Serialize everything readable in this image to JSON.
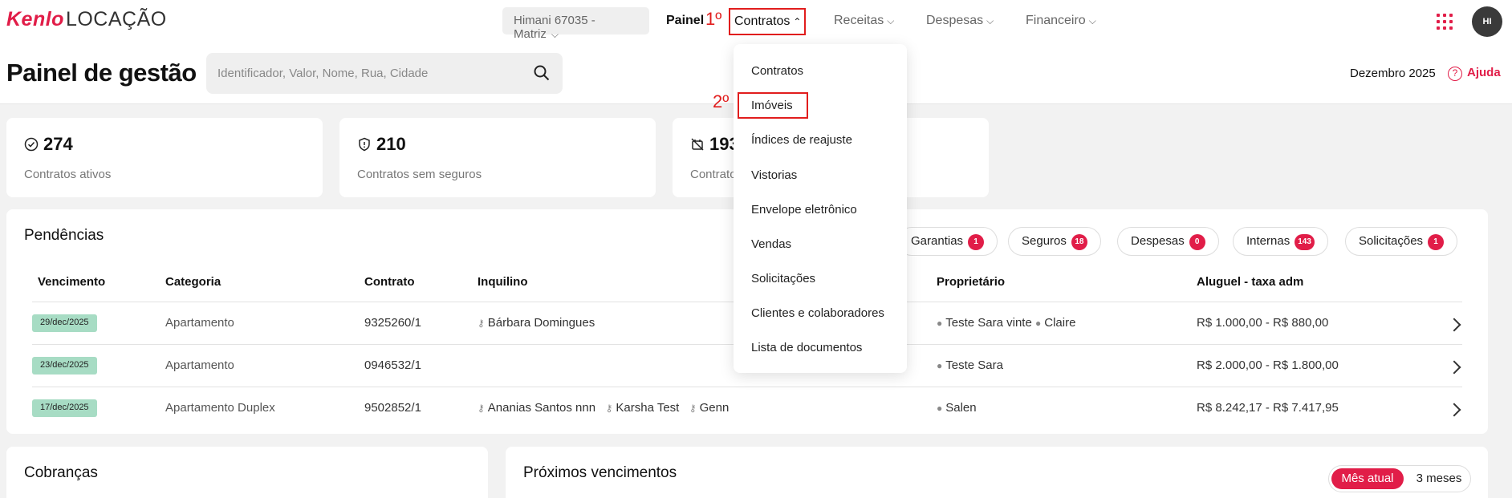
{
  "logo": {
    "brand": "Kenlo",
    "product": "LOCAÇÃO"
  },
  "topnav": {
    "branch": "Himani 67035 - Matriz",
    "painel": "Painel",
    "contratos": "Contratos",
    "receitas": "Receitas",
    "despesas": "Despesas",
    "financeiro": "Financeiro",
    "avatar_initials": "HI"
  },
  "annotations": {
    "step1": "1º",
    "step2": "2º"
  },
  "header": {
    "title": "Painel de gestão",
    "search_placeholder": "Identificador, Valor, Nome, Rua, Cidade",
    "month": "Dezembro 2025",
    "help": "Ajuda"
  },
  "stats": [
    {
      "value": "274",
      "label": "Contratos ativos",
      "icon": "check-circle-icon"
    },
    {
      "value": "210",
      "label": "Contratos sem seguros",
      "icon": "shield-icon"
    },
    {
      "value": "193",
      "label": "Contrato",
      "icon": "no-alarm-icon"
    }
  ],
  "pendencias": {
    "title": "Pendências",
    "chips": [
      {
        "label": "Garantias",
        "count": "1"
      },
      {
        "label": "Seguros",
        "count": "18"
      },
      {
        "label": "Despesas",
        "count": "0"
      },
      {
        "label": "Internas",
        "count": "143"
      },
      {
        "label": "Solicitações",
        "count": "1"
      }
    ],
    "columns": [
      "Vencimento",
      "Categoria",
      "Contrato",
      "Inquilino",
      "Proprietário",
      "Aluguel - taxa adm"
    ],
    "rows": [
      {
        "date": "29/dec/2025",
        "category": "Apartamento",
        "contract": "9325260/1",
        "tenants": [
          "Bárbara Domingues"
        ],
        "owners": [
          "Teste Sara vinte",
          "Claire"
        ],
        "rent": "R$ 1.000,00 - R$ 880,00"
      },
      {
        "date": "23/dec/2025",
        "category": "Apartamento",
        "contract": "0946532/1",
        "tenants": [],
        "owners": [
          "Teste Sara"
        ],
        "rent": "R$ 2.000,00 - R$ 1.800,00"
      },
      {
        "date": "17/dec/2025",
        "category": "Apartamento Duplex",
        "contract": "9502852/1",
        "tenants": [
          "Ananias Santos nnn",
          "Karsha Test",
          "Genn"
        ],
        "owners": [
          "Salen"
        ],
        "rent": "R$ 8.242,17 - R$ 7.417,95"
      }
    ]
  },
  "cobrancas": {
    "title": "Cobranças"
  },
  "proximos": {
    "title": "Próximos vencimentos",
    "seg_active": "Mês atual",
    "seg_other": "3 meses"
  },
  "dropdown": {
    "items": [
      "Contratos",
      "Imóveis",
      "Índices de reajuste",
      "Vistorias",
      "Envelope eletrônico",
      "Vendas",
      "Solicitações",
      "Clientes e colaboradores",
      "Lista de documentos"
    ]
  },
  "colors": {
    "accent": "#e11d48",
    "annotation": "#e11d1d",
    "date_badge": "#a7dcc4"
  }
}
